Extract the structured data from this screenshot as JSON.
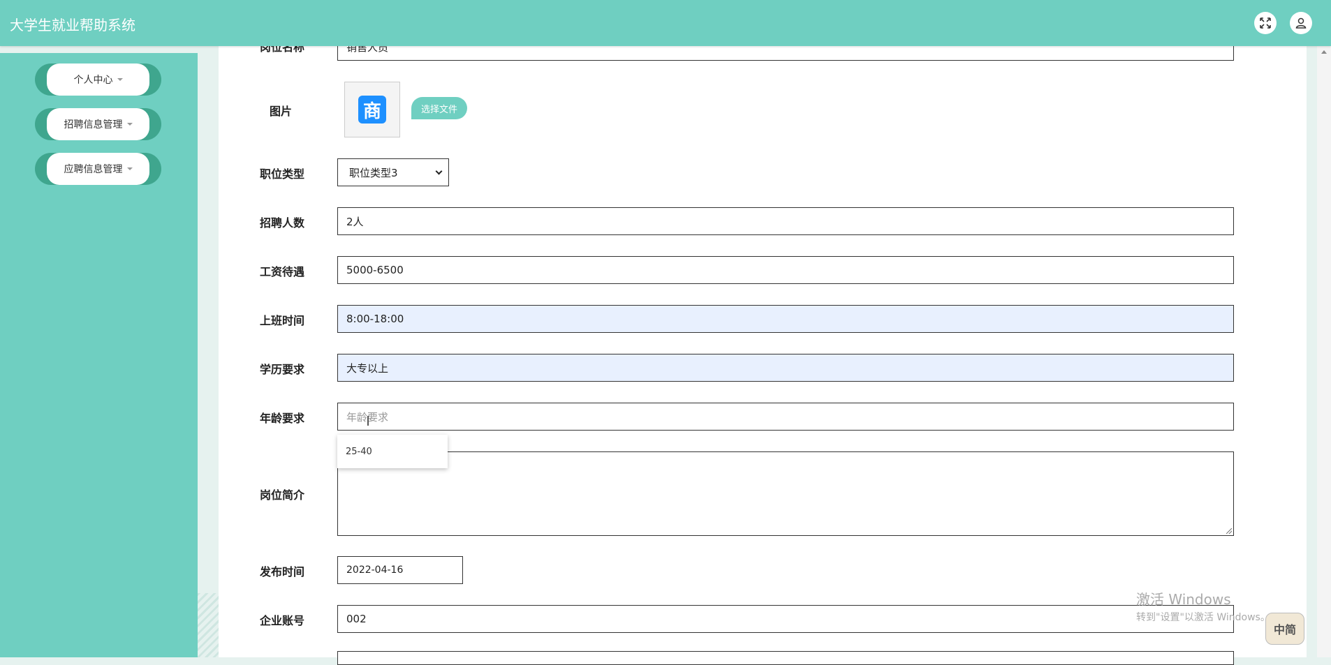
{
  "app": {
    "title": "大学生就业帮助系统"
  },
  "header": {
    "fullscreen_icon": "fullscreen-icon",
    "user_icon": "user-icon"
  },
  "sidebar": {
    "items": [
      {
        "label": "个人中心"
      },
      {
        "label": "招聘信息管理"
      },
      {
        "label": "应聘信息管理"
      }
    ]
  },
  "form": {
    "position_name": {
      "label": "岗位名称",
      "value": "销售人员"
    },
    "image": {
      "label": "图片",
      "button": "选择文件",
      "thumb_glyph": "商"
    },
    "job_type": {
      "label": "职位类型",
      "value": "职位类型3"
    },
    "headcount": {
      "label": "招聘人数",
      "value": "2人"
    },
    "salary": {
      "label": "工资待遇",
      "value": "5000-6500"
    },
    "work_hours": {
      "label": "上班时间",
      "value": "8:00-18:00"
    },
    "education": {
      "label": "学历要求",
      "value": "大专以上"
    },
    "age": {
      "label": "年龄要求",
      "placeholder": "年龄要求",
      "suggestion": "25-40"
    },
    "intro": {
      "label": "岗位简介",
      "value": ""
    },
    "publish_time": {
      "label": "发布时间",
      "value": "2022-04-16"
    },
    "company_account": {
      "label": "企业账号",
      "value": "002"
    }
  },
  "overlay": {
    "watermark_line1": "激活 Windows",
    "watermark_line2": "转到\"设置\"以激活 Windows。",
    "ime_label": "中简"
  },
  "colors": {
    "primary": "#6fcfc1",
    "sidebar_accent": "#3fa68e",
    "autofill": "#e8f0fe"
  }
}
